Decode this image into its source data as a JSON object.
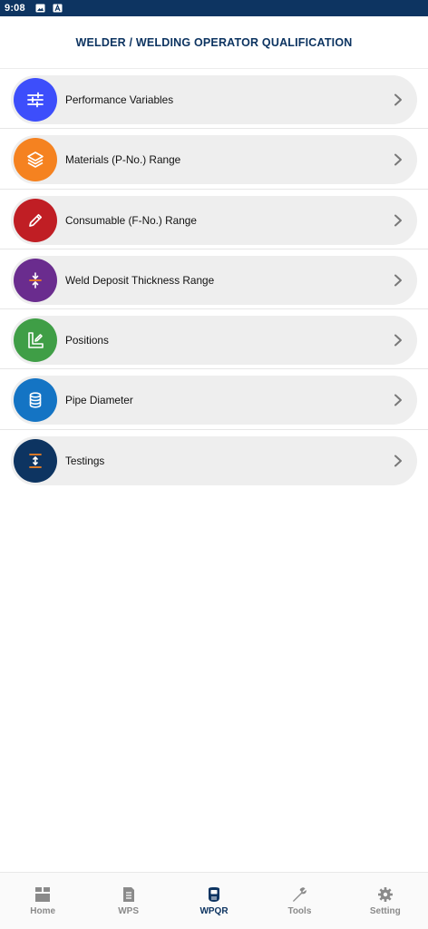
{
  "status_bar": {
    "time": "9:08"
  },
  "header": {
    "title": "WELDER / WELDING OPERATOR QUALIFICATION"
  },
  "items": [
    {
      "label": "Performance Variables",
      "color": "#3d4efb",
      "icon": "sliders-icon"
    },
    {
      "label": "Materials (P-No.) Range",
      "color": "#f58220",
      "icon": "layers-icon"
    },
    {
      "label": "Consumable (F-No.) Range",
      "color": "#c01e24",
      "icon": "pencil-icon"
    },
    {
      "label": "Weld Deposit Thickness Range",
      "color": "#6a2c8e",
      "icon": "compress-icon"
    },
    {
      "label": "Positions",
      "color": "#3f9e46",
      "icon": "angle-edit-icon"
    },
    {
      "label": "Pipe Diameter",
      "color": "#1474c4",
      "icon": "database-icon"
    },
    {
      "label": "Testings",
      "color": "#0d3461",
      "icon": "height-icon"
    }
  ],
  "nav": [
    {
      "label": "Home",
      "icon": "home-icon",
      "active": false
    },
    {
      "label": "WPS",
      "icon": "document-icon",
      "active": false
    },
    {
      "label": "WPQR",
      "icon": "welding-mask-icon",
      "active": true
    },
    {
      "label": "Tools",
      "icon": "wrench-icon",
      "active": false
    },
    {
      "label": "Setting",
      "icon": "gear-icon",
      "active": false
    }
  ],
  "colors": {
    "primary": "#0d3461",
    "inactive": "#8a8a8a",
    "accent_orange": "#f58220"
  }
}
